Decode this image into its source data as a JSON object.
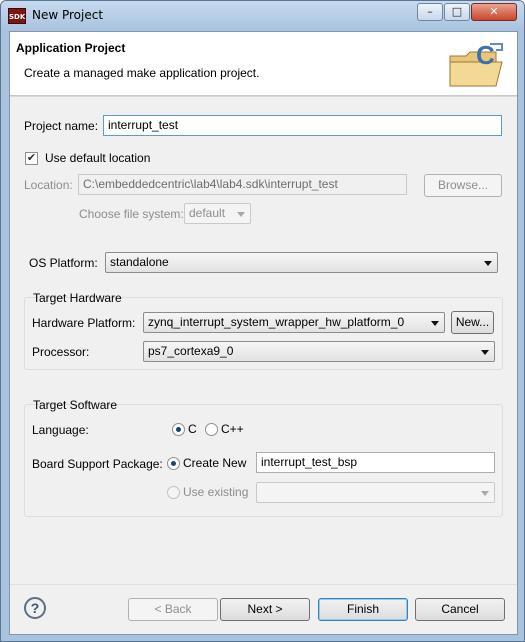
{
  "window": {
    "app_icon_text": "SDK",
    "title": "New Project",
    "minimize_glyph": "–",
    "maximize_glyph": "□",
    "close_glyph": "✕"
  },
  "header": {
    "title": "Application Project",
    "description": "Create a managed make application project.",
    "image_icon": "c-project-folder-icon"
  },
  "project": {
    "name_label": "Project name:",
    "name_value": "interrupt_test",
    "use_default_label": "Use default location",
    "use_default_checked": true,
    "location_label": "Location:",
    "location_value": "C:\\embeddedcentric\\lab4\\lab4.sdk\\interrupt_test",
    "browse_label": "Browse...",
    "file_system_label": "Choose file system:",
    "file_system_value": "default"
  },
  "os_platform": {
    "label": "OS Platform:",
    "value": "standalone"
  },
  "target_hardware": {
    "title": "Target Hardware",
    "hw_platform_label": "Hardware Platform:",
    "hw_platform_value": "zynq_interrupt_system_wrapper_hw_platform_0",
    "new_button": "New...",
    "processor_label": "Processor:",
    "processor_value": "ps7_cortexa9_0"
  },
  "target_software": {
    "title": "Target Software",
    "language_label": "Language:",
    "lang_c": "C",
    "lang_cpp": "C++",
    "selected_language": "C",
    "bsp_label": "Board Support Package:",
    "create_new_label": "Create New",
    "bsp_name": "interrupt_test_bsp",
    "use_existing_label": "Use existing",
    "existing_value": ""
  },
  "footer": {
    "back_label": "< Back",
    "next_label": "Next >",
    "finish_label": "Finish",
    "cancel_label": "Cancel"
  },
  "colors": {
    "frame": "#a9c3de",
    "client": "#f0f0f0",
    "default_button_border": "#3c7fb1"
  }
}
